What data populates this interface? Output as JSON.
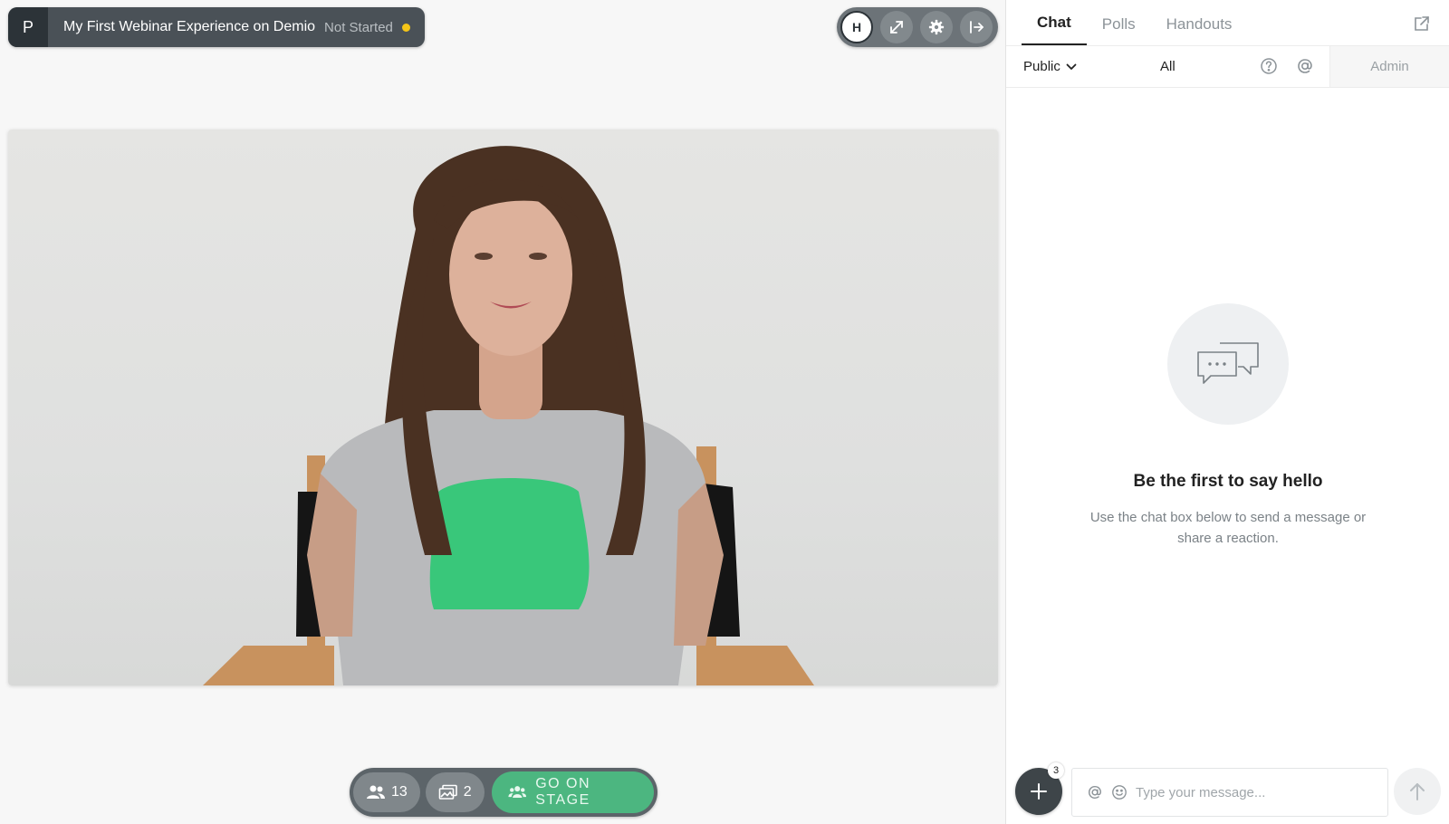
{
  "session": {
    "initial": "P",
    "title": "My First Webinar Experience on Demio",
    "status": "Not Started",
    "status_color": "#f5c518"
  },
  "toolbar": {
    "avatar_initial": "H",
    "icons": [
      "expand-icon",
      "gear-icon",
      "exit-icon"
    ]
  },
  "stage_controls": {
    "attendees_count": "13",
    "media_count": "2",
    "go_on_stage_label": "GO ON STAGE"
  },
  "chat_panel": {
    "tabs": [
      {
        "label": "Chat",
        "active": true
      },
      {
        "label": "Polls",
        "active": false
      },
      {
        "label": "Handouts",
        "active": false
      }
    ],
    "visibility_selected": "Public",
    "recipient_filter": "All",
    "admin_label": "Admin",
    "empty_title": "Be the first to say hello",
    "empty_text": "Use the chat box below to send a message or share a reaction.",
    "composer": {
      "placeholder": "Type your message...",
      "reactions_badge": "3"
    }
  },
  "colors": {
    "go_stage_green": "#4cb680",
    "dark_panel": "#4a5157"
  }
}
